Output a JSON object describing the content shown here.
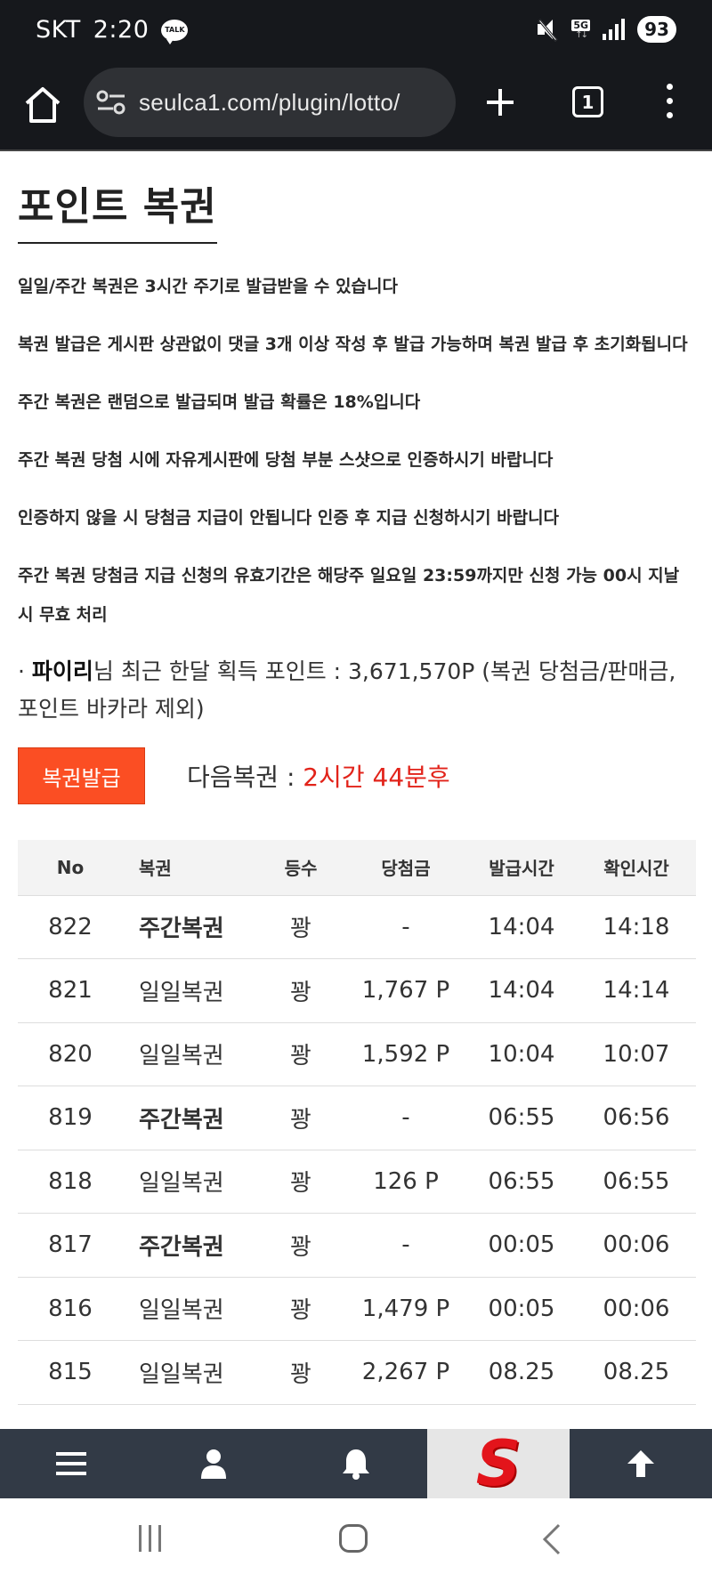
{
  "status_bar": {
    "carrier": "SKT",
    "time": "2:20",
    "talk_badge": "TALK",
    "network": "5G",
    "battery": "93"
  },
  "browser": {
    "url": "seulca1.com/plugin/lotto/",
    "tab_count": "1"
  },
  "page": {
    "title": "포인트 복권",
    "notices": [
      "일일/주간 복권은 3시간 주기로 발급받을 수 있습니다",
      "복권 발급은 게시판 상관없이 댓글 3개 이상 작성 후 발급 가능하며 복권 발급 후 초기화됩니다",
      "주간 복권은 랜덤으로 발급되며 발급 확률은 18%입니다",
      "주간 복권 당첨 시에 자유게시판에 당첨 부분 스샷으로 인증하시기 바랍니다",
      "인증하지 않을 시 당첨금 지급이 안됩니다 인증 후 지급 신청하시기 바랍니다",
      "주간 복권 당첨금 지급 신청의 유효기간은 해당주 일요일 23:59까지만 신청 가능 00시 지날시 무효 처리"
    ],
    "points": {
      "bullet": "·",
      "nickname": "파이리",
      "text": "님 최근 한달 획득 포인트 : 3,671,570P (복권 당첨금/판매금, 포인트 바카라 제외)"
    },
    "issue_button": "복권발급",
    "next_label": "다음복권 : ",
    "next_remaining": "2시간 44분후"
  },
  "table": {
    "headers": [
      "No",
      "복권",
      "등수",
      "당첨금",
      "발급시간",
      "확인시간"
    ],
    "rows": [
      {
        "no": "822",
        "type": "주간복권",
        "weekly": true,
        "rank": "꽝",
        "prize": "-",
        "issued": "14:04",
        "checked": "14:18"
      },
      {
        "no": "821",
        "type": "일일복권",
        "weekly": false,
        "rank": "꽝",
        "prize": "1,767 P",
        "issued": "14:04",
        "checked": "14:14"
      },
      {
        "no": "820",
        "type": "일일복권",
        "weekly": false,
        "rank": "꽝",
        "prize": "1,592 P",
        "issued": "10:04",
        "checked": "10:07"
      },
      {
        "no": "819",
        "type": "주간복권",
        "weekly": true,
        "rank": "꽝",
        "prize": "-",
        "issued": "06:55",
        "checked": "06:56"
      },
      {
        "no": "818",
        "type": "일일복권",
        "weekly": false,
        "rank": "꽝",
        "prize": "126 P",
        "issued": "06:55",
        "checked": "06:55"
      },
      {
        "no": "817",
        "type": "주간복권",
        "weekly": true,
        "rank": "꽝",
        "prize": "-",
        "issued": "00:05",
        "checked": "00:06"
      },
      {
        "no": "816",
        "type": "일일복권",
        "weekly": false,
        "rank": "꽝",
        "prize": "1,479 P",
        "issued": "00:05",
        "checked": "00:06"
      },
      {
        "no": "815",
        "type": "일일복권",
        "weekly": false,
        "rank": "꽝",
        "prize": "2,267 P",
        "issued": "08.25",
        "checked": "08.25"
      }
    ]
  },
  "site_bar": {
    "logo_letter": "S",
    "icons": [
      "menu-icon",
      "user-icon",
      "bell-icon",
      "site-logo",
      "arrow-up-icon"
    ]
  },
  "colors": {
    "issue_button_bg": "#fb4e23",
    "remaining_text": "#e2231a",
    "site_bar_bg": "#323a46",
    "browser_bg": "#16181c"
  }
}
